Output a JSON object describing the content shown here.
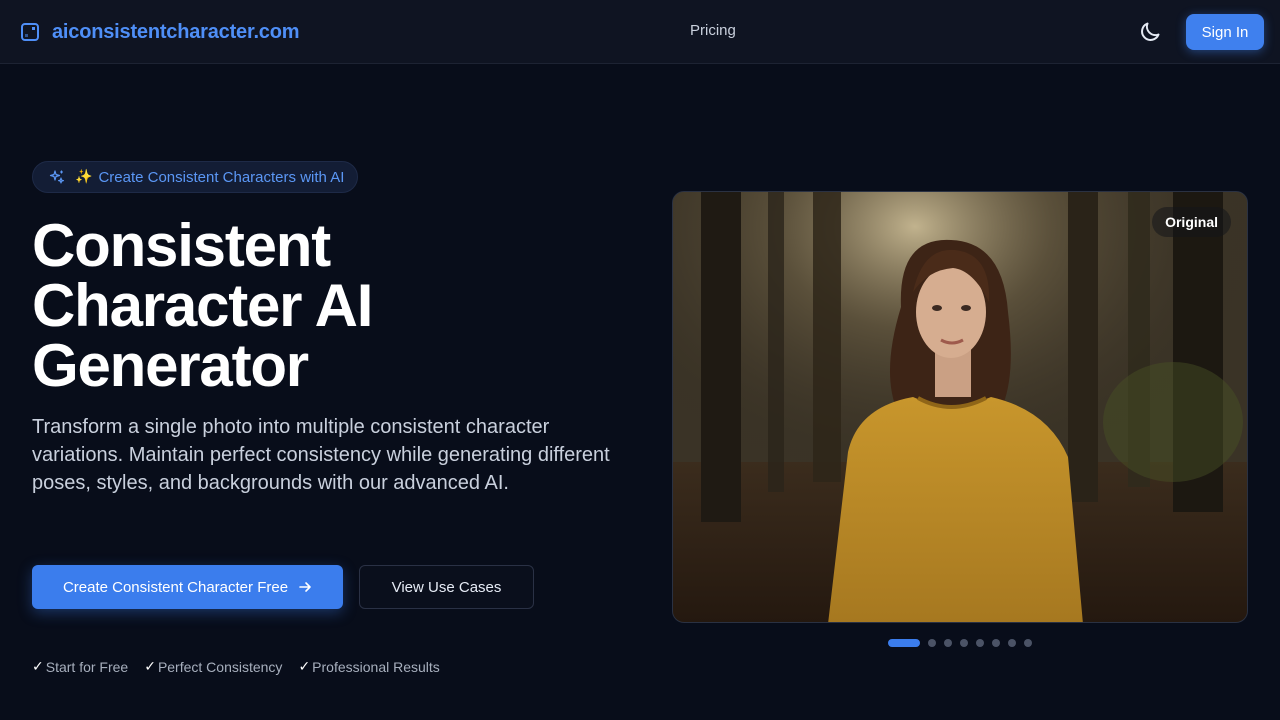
{
  "header": {
    "logo_text": "aiconsistentcharacter.com",
    "nav_pricing": "Pricing",
    "signin_label": "Sign In"
  },
  "hero": {
    "badge_emoji": "✨",
    "badge_text": "Create Consistent Characters with AI",
    "title_lines": [
      "Consistent",
      "Character AI",
      "Generator"
    ],
    "description": "Transform a single photo into multiple consistent character variations. Maintain perfect consistency while generating different poses, styles, and backgrounds with our advanced AI.",
    "primary_cta": "Create Consistent Character Free",
    "secondary_cta": "View Use Cases",
    "features": [
      "Start for Free",
      "Perfect Consistency",
      "Professional Results"
    ],
    "check_glyph": "✓"
  },
  "showcase": {
    "label": "Original",
    "slide_count": 8,
    "active_slide": 1
  },
  "colors": {
    "accent": "#3b7ded",
    "background": "#080d1a",
    "header_bg": "#0f1422"
  },
  "icons": {
    "logo": "logo-square-icon",
    "theme": "moon-icon",
    "badge": "sparkles-icon",
    "cta": "arrow-right-icon"
  }
}
